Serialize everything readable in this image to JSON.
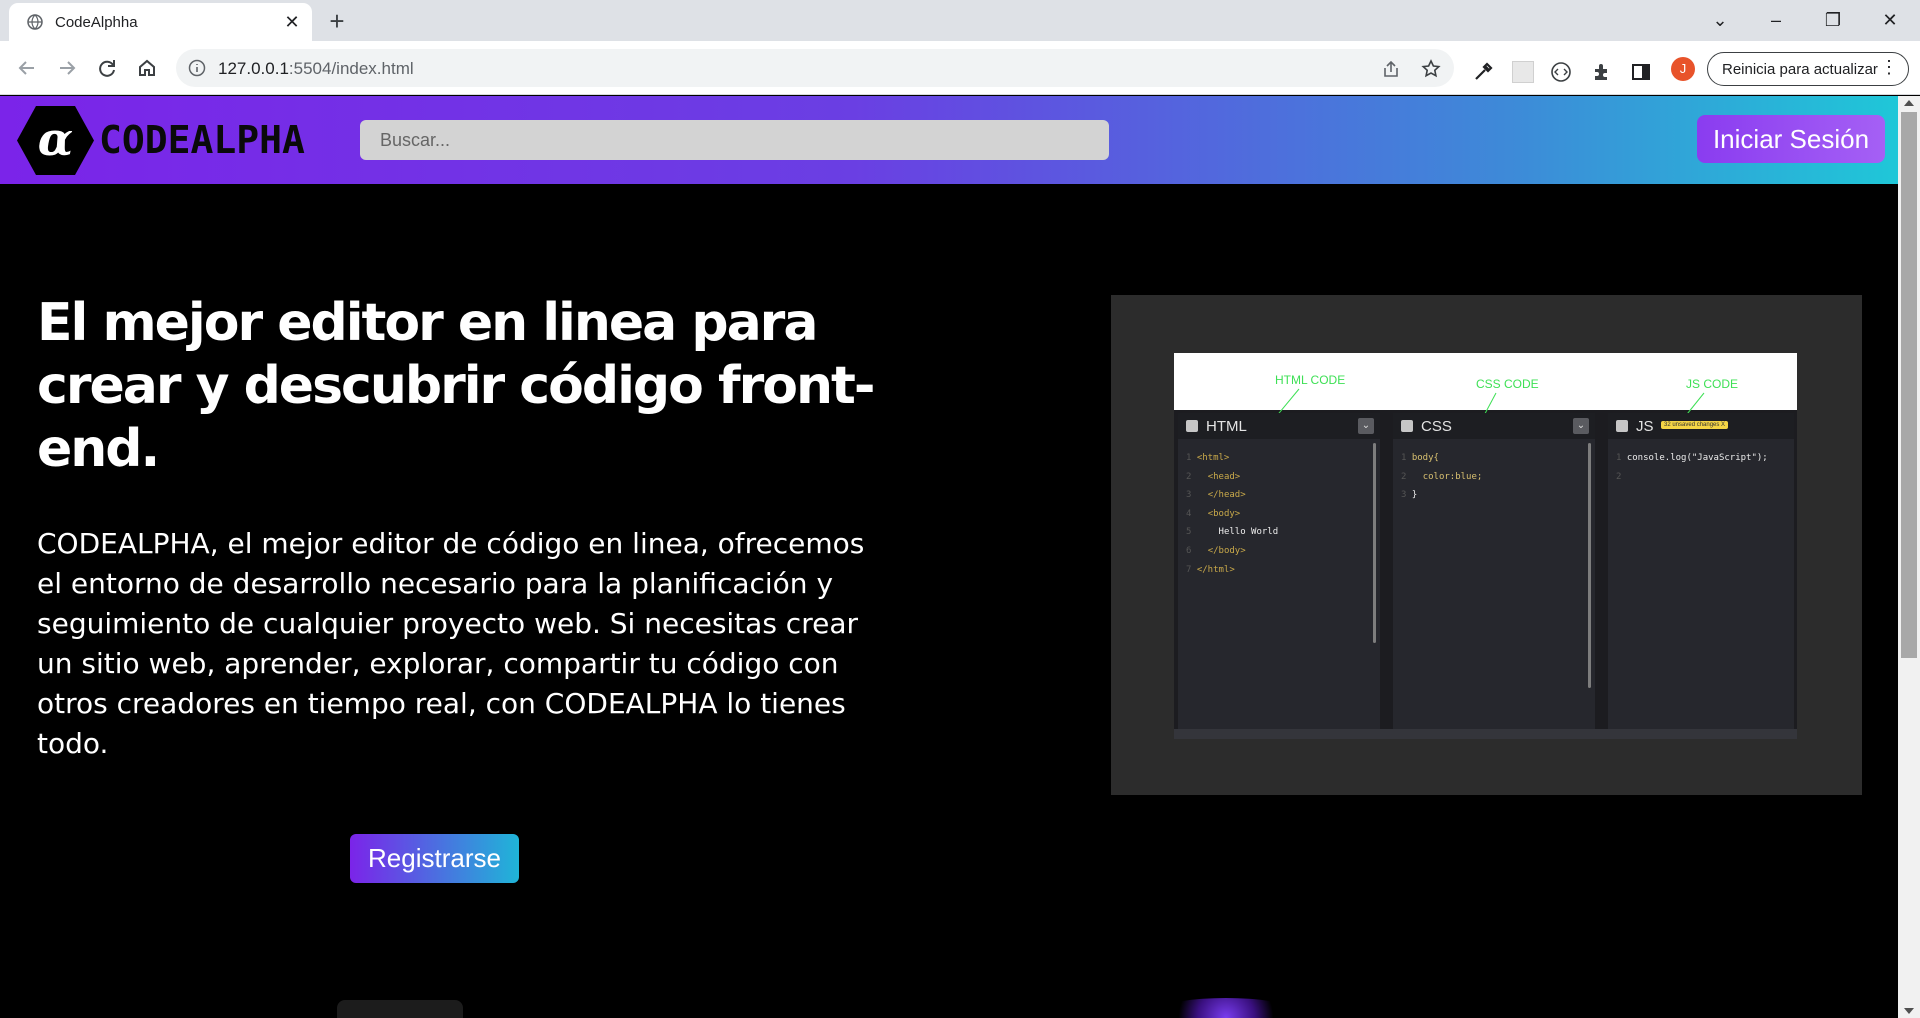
{
  "browser": {
    "tab_title": "CodeAlphha",
    "tab_close": "✕",
    "new_tab": "+",
    "url_host": "127.0.0.1",
    "url_rest": ":5504/index.html",
    "profile_initial": "J",
    "update_label": "Reinicia para actualizar",
    "menu_dots": "⋮",
    "window_controls": {
      "chevron": "⌄",
      "minimize": "–",
      "restore": "❐",
      "close": "✕"
    }
  },
  "site": {
    "logo_mark": "α",
    "logo_text": "CODEALPHA",
    "search_placeholder": "Buscar...",
    "login_label": "Iniciar Sesión",
    "hero_title": "El mejor editor en linea para crear y descubrir código front-end.",
    "hero_description": "CODEALPHA, el mejor editor de código en linea, ofrecemos el entorno de desarrollo necesario para la planificación y seguimiento de cualquier proyecto web. Si necesitas crear un sitio web, aprender, explorar, compartir tu código con otros creadores en tiempo real, con CODEALPHA lo tienes todo.",
    "register_label": "Registrarse"
  },
  "preview": {
    "annotations": {
      "html": "HTML CODE",
      "css": "CSS CODE",
      "js": "JS CODE"
    },
    "panes": {
      "html": "HTML",
      "css": "CSS",
      "js": "JS"
    },
    "unsaved_badge": "32 unsaved changes X",
    "html_code": [
      "<html>",
      "<head>",
      "</head>",
      "<body>",
      "Hello World",
      "</body>",
      "</html>"
    ],
    "css_code": [
      "body{",
      "color:blue;",
      "}"
    ],
    "js_code": [
      "console.log(\"JavaScript\");"
    ]
  },
  "colors": {
    "navbar_gradient_start": "#7b24e9",
    "navbar_gradient_end": "#1fc7d8",
    "annotation_green": "#3ee055",
    "page_background": "#000000"
  },
  "icons": [
    "globe-icon",
    "back-icon",
    "forward-icon",
    "reload-icon",
    "home-icon",
    "info-icon",
    "share-icon",
    "star-icon",
    "eyedropper-icon",
    "extensions-icon",
    "sidebar-icon",
    "code-icon"
  ]
}
